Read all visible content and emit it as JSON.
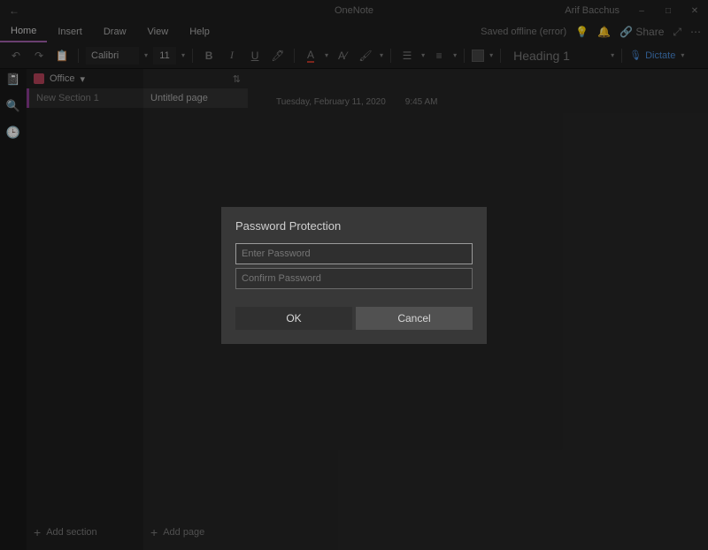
{
  "title": {
    "app": "OneNote",
    "user": "Arif Bacchus"
  },
  "menu": {
    "items": [
      "Home",
      "Insert",
      "Draw",
      "View",
      "Help"
    ],
    "active_index": 0,
    "status": "Saved offline (error)",
    "share": "Share"
  },
  "ribbon": {
    "font_name": "Calibri",
    "font_size": "11",
    "heading_style": "Heading 1",
    "dictate": "Dictate"
  },
  "navigation": {
    "notebook": "Office",
    "section": "New Section 1",
    "page": "Untitled page",
    "add_section": "Add section",
    "add_page": "Add page"
  },
  "canvas": {
    "date": "Tuesday, February 11, 2020",
    "time": "9:45 AM"
  },
  "dialog": {
    "title": "Password Protection",
    "password_placeholder": "Enter Password",
    "confirm_placeholder": "Confirm Password",
    "ok": "OK",
    "cancel": "Cancel"
  }
}
